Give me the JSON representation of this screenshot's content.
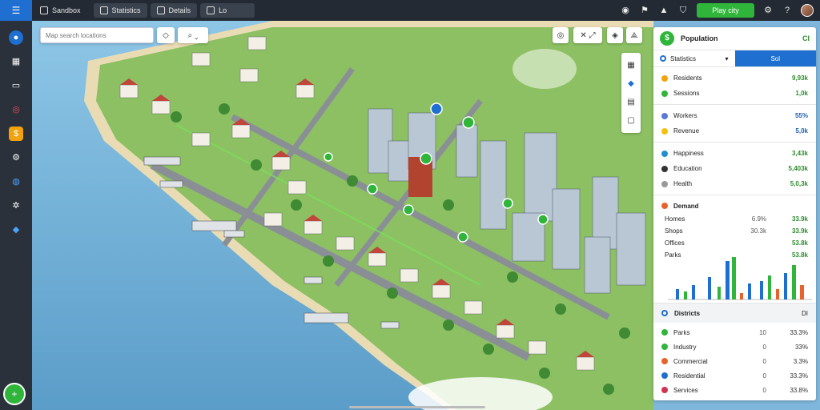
{
  "topbar": {
    "menu_label": "Sandbox",
    "view_label": "Statistics",
    "tool_label": "Details",
    "mode_label": "Lo",
    "play_label": "Play city"
  },
  "sidebar": {
    "items": [
      "home",
      "buildings",
      "monitor",
      "alerts",
      "coins",
      "settings",
      "network",
      "utilities",
      "transport"
    ]
  },
  "map": {
    "search_placeholder": "Map search locations"
  },
  "panel": {
    "title": "Population",
    "title_value": "CI",
    "tab_select": "Statistics",
    "tab_active": "Sol",
    "stats1": [
      {
        "label": "Residents",
        "value": "9,93k",
        "color": "#f2a20c"
      },
      {
        "label": "Sessions",
        "value": "1,0k",
        "color": "#2fb53a"
      }
    ],
    "stats2": [
      {
        "label": "Workers",
        "value": "55%",
        "color": "#5b7ad6"
      },
      {
        "label": "Revenue",
        "value": "5,0k",
        "color": "#f2c20c"
      }
    ],
    "stats3": [
      {
        "label": "Happiness",
        "value": "3,43k",
        "color": "#1f8fd0"
      },
      {
        "label": "Education",
        "value": "5,403k",
        "color": "#333333"
      },
      {
        "label": "Health",
        "value": "5,0,3k",
        "color": "#999999"
      }
    ],
    "chart": {
      "title": "Demand",
      "rows": [
        {
          "label": "Homes",
          "mid": "6.9%",
          "value": "33.9k"
        },
        {
          "label": "Shops",
          "mid": "30.3k",
          "value": "33.9k"
        },
        {
          "label": "Offices",
          "mid": "",
          "value": "53.8k"
        },
        {
          "label": "Parks",
          "mid": "",
          "value": "53.8k"
        }
      ]
    },
    "legend": {
      "title": "Districts",
      "close": "DI",
      "items": [
        {
          "label": "Parks",
          "mid": "10",
          "value": "33.3%",
          "color": "#2fb53a"
        },
        {
          "label": "Industry",
          "mid": "0",
          "value": "33%",
          "color": "#2fb53a"
        },
        {
          "label": "Commercial",
          "mid": "0",
          "value": "3.3%",
          "color": "#e8622c"
        },
        {
          "label": "Residential",
          "mid": "0",
          "value": "33.3%",
          "color": "#1f6fd0"
        },
        {
          "label": "Services",
          "mid": "0",
          "value": "33.8%",
          "color": "#d0334f"
        }
      ]
    }
  }
}
